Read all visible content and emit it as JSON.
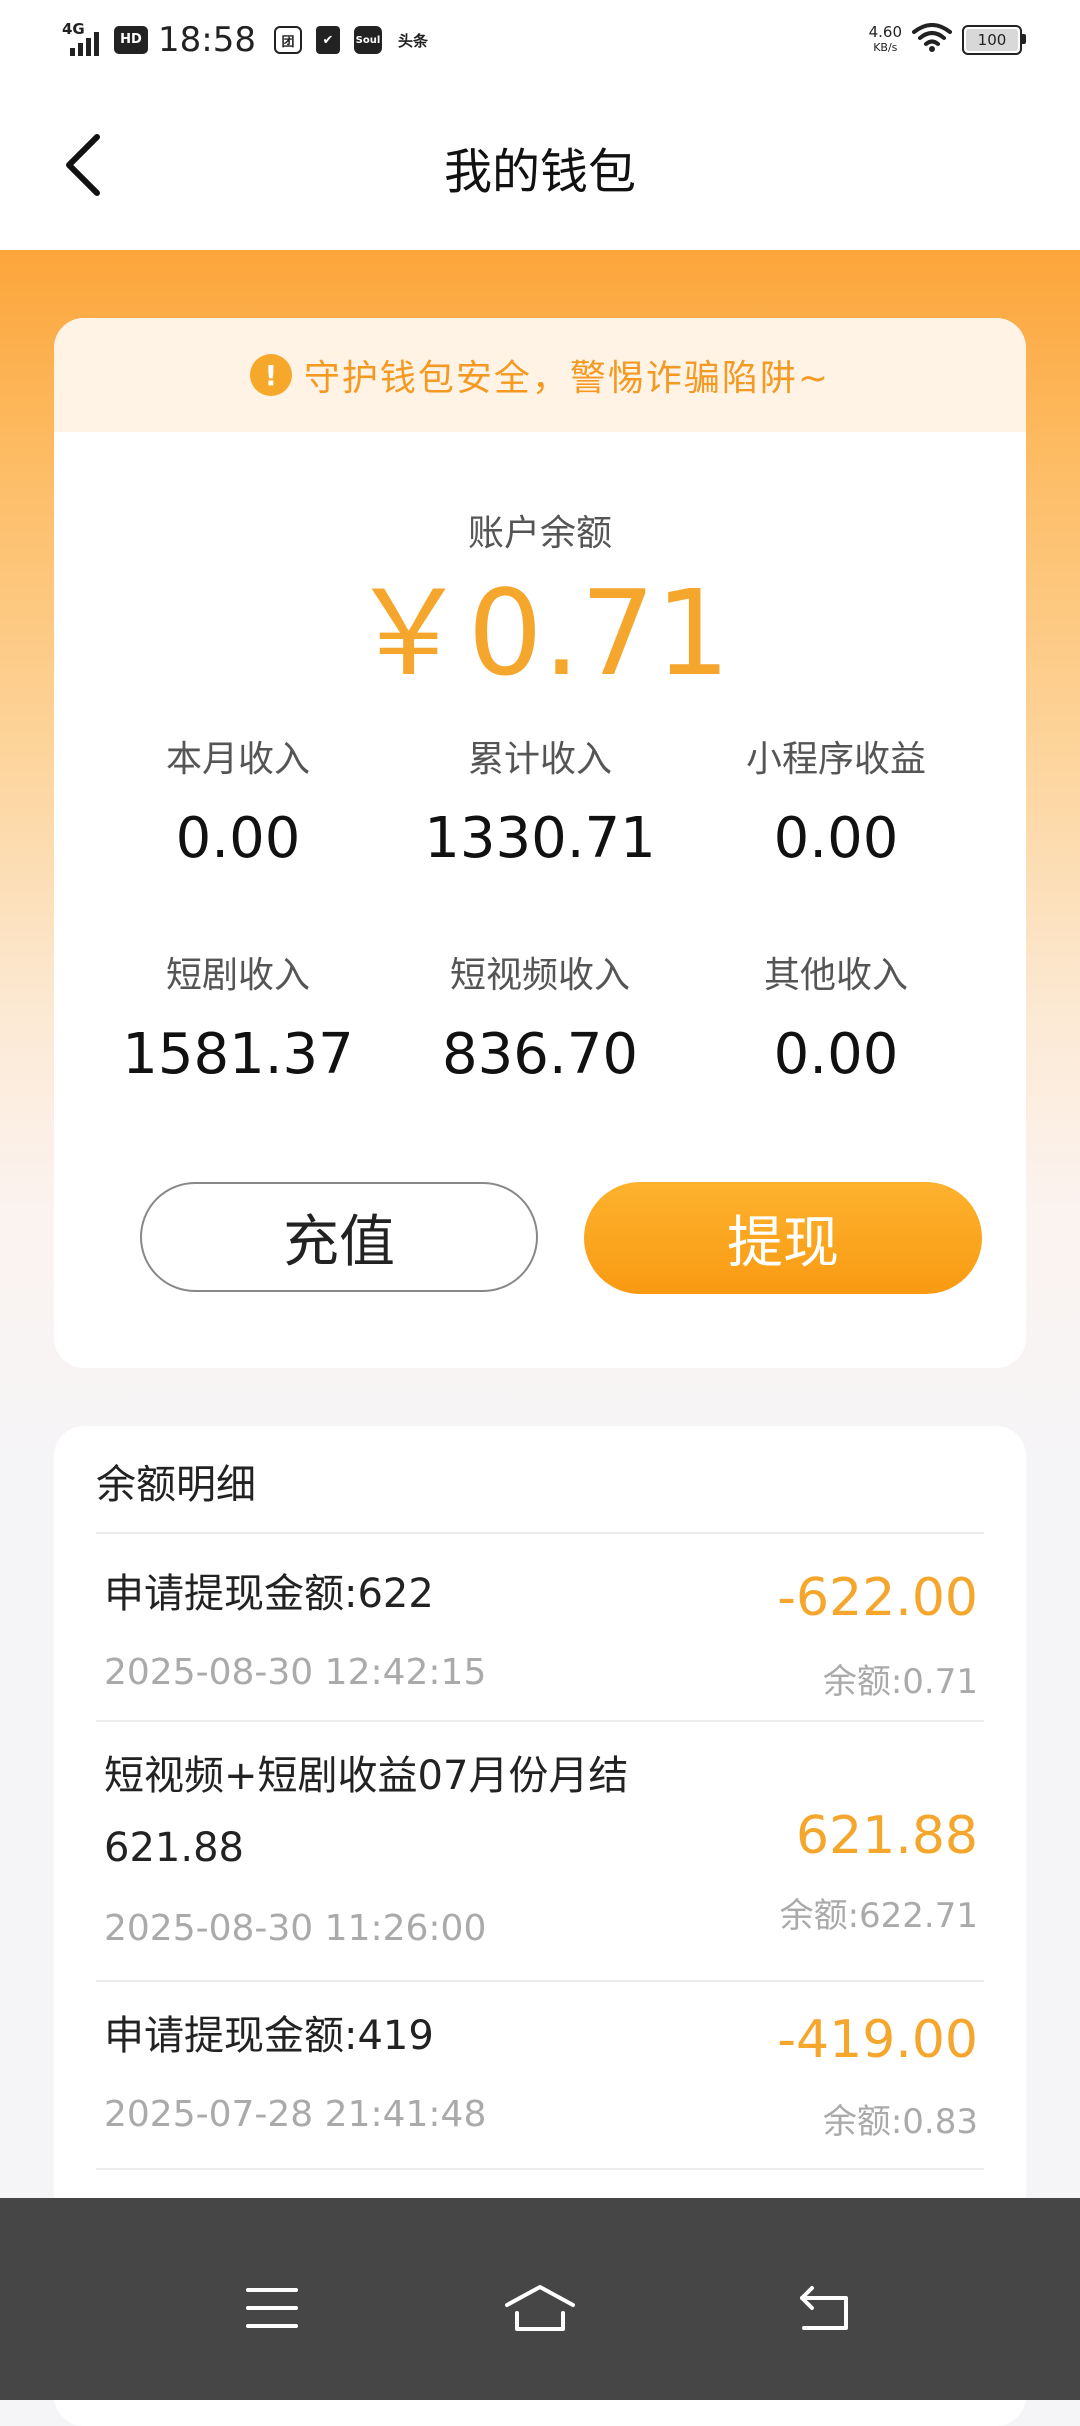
{
  "status_bar": {
    "network": "4G",
    "hd": "HD",
    "time": "18:58",
    "app_icons": [
      "团",
      "✔",
      "Soul",
      "头条"
    ],
    "speed_value": "4.60",
    "speed_unit": "KB/s",
    "battery": "100"
  },
  "header": {
    "title": "我的钱包"
  },
  "wallet": {
    "notice": "守护钱包安全，警惕诈骗陷阱~",
    "balance_label": "账户余额",
    "balance": "￥0.71",
    "stats": [
      {
        "label": "本月收入",
        "value": "0.00"
      },
      {
        "label": "累计收入",
        "value": "1330.71"
      },
      {
        "label": "小程序收益",
        "value": "0.00"
      },
      {
        "label": "短剧收入",
        "value": "1581.37"
      },
      {
        "label": "短视频收入",
        "value": "836.70"
      },
      {
        "label": "其他收入",
        "value": "0.00"
      }
    ],
    "recharge_label": "充值",
    "withdraw_label": "提现"
  },
  "details": {
    "title": "余额明细",
    "transactions": [
      {
        "desc_line1": "申请提现金额:622",
        "desc_line2": "",
        "date": "2025-08-30 12:42:15",
        "amount": "-622.00",
        "balance": "余额:0.71"
      },
      {
        "desc_line1": "短视频+短剧收益07月份月结",
        "desc_line2": "621.88",
        "date": "2025-08-30 11:26:00",
        "amount": "621.88",
        "balance": "余额:622.71"
      },
      {
        "desc_line1": "申请提现金额:419",
        "desc_line2": "",
        "date": "2025-07-28 21:41:48",
        "amount": "-419.00",
        "balance": "余额:0.83"
      }
    ]
  },
  "colors": {
    "accent": "#f5a62c",
    "notice_bg": "#fff3e6",
    "nav_bg": "#464646"
  },
  "icons": {
    "back": "chevron-left-icon",
    "warning": "exclamation-circle-icon",
    "menu": "menu-icon",
    "home": "home-icon",
    "return": "return-icon"
  }
}
